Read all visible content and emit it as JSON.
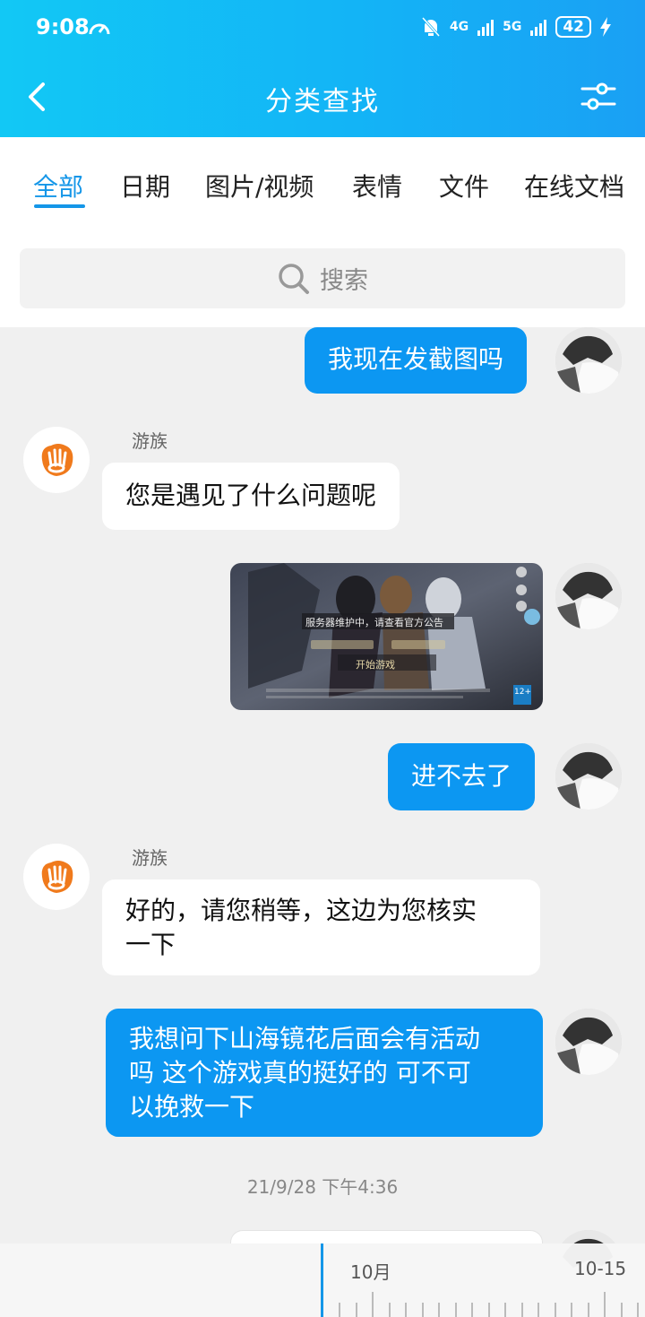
{
  "status_bar": {
    "time": "9:08",
    "network_1": "4G",
    "network_2": "5G",
    "battery": "42"
  },
  "nav": {
    "title": "分类查找"
  },
  "tabs": [
    "全部",
    "日期",
    "图片/视频",
    "表情",
    "文件",
    "在线文档"
  ],
  "search": {
    "placeholder": "搜索"
  },
  "messages": {
    "m1": "我现在发截图吗",
    "m2_sender": "游族",
    "m2": "您是遇见了什么问题呢",
    "m3_image_caption": "服务器维护中，请查看官方公告",
    "m3_image_button": "开始游戏",
    "m3_image_rating": "12+",
    "m4": "进不去了",
    "m5_sender": "游族",
    "m5_line1": "好的，请您稍等，这边为您核实",
    "m5_line2": "一下",
    "m6_line1": "我想问下山海镜花后面会有活动",
    "m6_line2": "吗 这个游戏真的挺好的 可不可",
    "m6_line3": "以挽救一下"
  },
  "timestamp": "21/9/28 下午4:36",
  "timeline": {
    "label_left": "10月",
    "label_right": "10-15"
  },
  "colors": {
    "accent": "#1496e8",
    "bubble_me": "#0c97f2",
    "header_start": "#12c8f5",
    "bot_logo": "#f07a1c"
  },
  "icons": [
    "back-arrow-icon",
    "filter-icon",
    "search-icon",
    "speed-icon",
    "mute-bell-icon",
    "bolt-icon",
    "signal-icon"
  ]
}
